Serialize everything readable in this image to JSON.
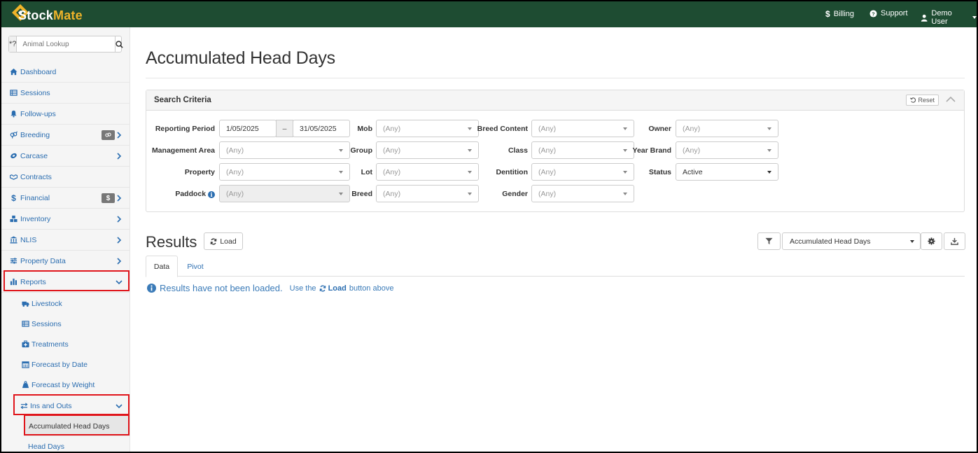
{
  "app": {
    "logo_text_a": "Stock",
    "logo_text_b": "Mate",
    "brand_color": "#1e4c32",
    "accent_color": "#f0b42a",
    "link_color": "#2a6db0",
    "highlight_color": "#e0151b"
  },
  "topnav": {
    "billing": "Billing",
    "support": "Support",
    "user": "Demo User"
  },
  "lookup": {
    "prefix": "*?",
    "placeholder": "Animal Lookup"
  },
  "sidebar": {
    "items": [
      {
        "label": "Dashboard",
        "icon": "home-icon"
      },
      {
        "label": "Sessions",
        "icon": "table-icon"
      },
      {
        "label": "Follow-ups",
        "icon": "bell-icon"
      },
      {
        "label": "Breeding",
        "icon": "venus-mars-icon"
      },
      {
        "label": "Carcase",
        "icon": "carcase-icon"
      },
      {
        "label": "Contracts",
        "icon": "handshake-icon"
      },
      {
        "label": "Financial",
        "icon": "dollar-icon",
        "badge": "$"
      },
      {
        "label": "Inventory",
        "icon": "cubes-icon"
      },
      {
        "label": "NLIS",
        "icon": "bank-icon"
      },
      {
        "label": "Property Data",
        "icon": "sliders-icon"
      },
      {
        "label": "Reports",
        "icon": "bar-chart-icon"
      }
    ],
    "report_sub": [
      {
        "label": "Livestock",
        "icon": "truck-icon"
      },
      {
        "label": "Sessions",
        "icon": "table-icon"
      },
      {
        "label": "Treatments",
        "icon": "medkit-icon"
      },
      {
        "label": "Forecast by Date",
        "icon": "calendar-icon"
      },
      {
        "label": "Forecast by Weight",
        "icon": "weight-icon"
      },
      {
        "label": "Ins and Outs",
        "icon": "exchange-icon"
      }
    ],
    "ins_outs_sub": [
      {
        "label": "Accumulated Head Days"
      },
      {
        "label": "Head Days"
      }
    ]
  },
  "page": {
    "title": "Accumulated Head Days"
  },
  "search": {
    "title": "Search Criteria",
    "reset": "Reset",
    "reporting_period_label": "Reporting Period",
    "date_from": "1/05/2025",
    "date_sep": "–",
    "date_to": "31/05/2025",
    "management_area_label": "Management Area",
    "property_label": "Property",
    "paddock_label": "Paddock",
    "mob_label": "Mob",
    "group_label": "Group",
    "lot_label": "Lot",
    "breed_label": "Breed",
    "breed_content_label": "Breed Content",
    "class_label": "Class",
    "dentition_label": "Dentition",
    "gender_label": "Gender",
    "owner_label": "Owner",
    "year_brand_label": "Year Brand",
    "status_label": "Status",
    "any": "(Any)",
    "status_value": "Active"
  },
  "results": {
    "title": "Results",
    "load": "Load",
    "report_select": "Accumulated Head Days",
    "tab_data": "Data",
    "tab_pivot": "Pivot",
    "msg_main": "Results have not been loaded.",
    "msg_use": "Use the",
    "msg_load": "Load",
    "msg_after": "button above"
  }
}
